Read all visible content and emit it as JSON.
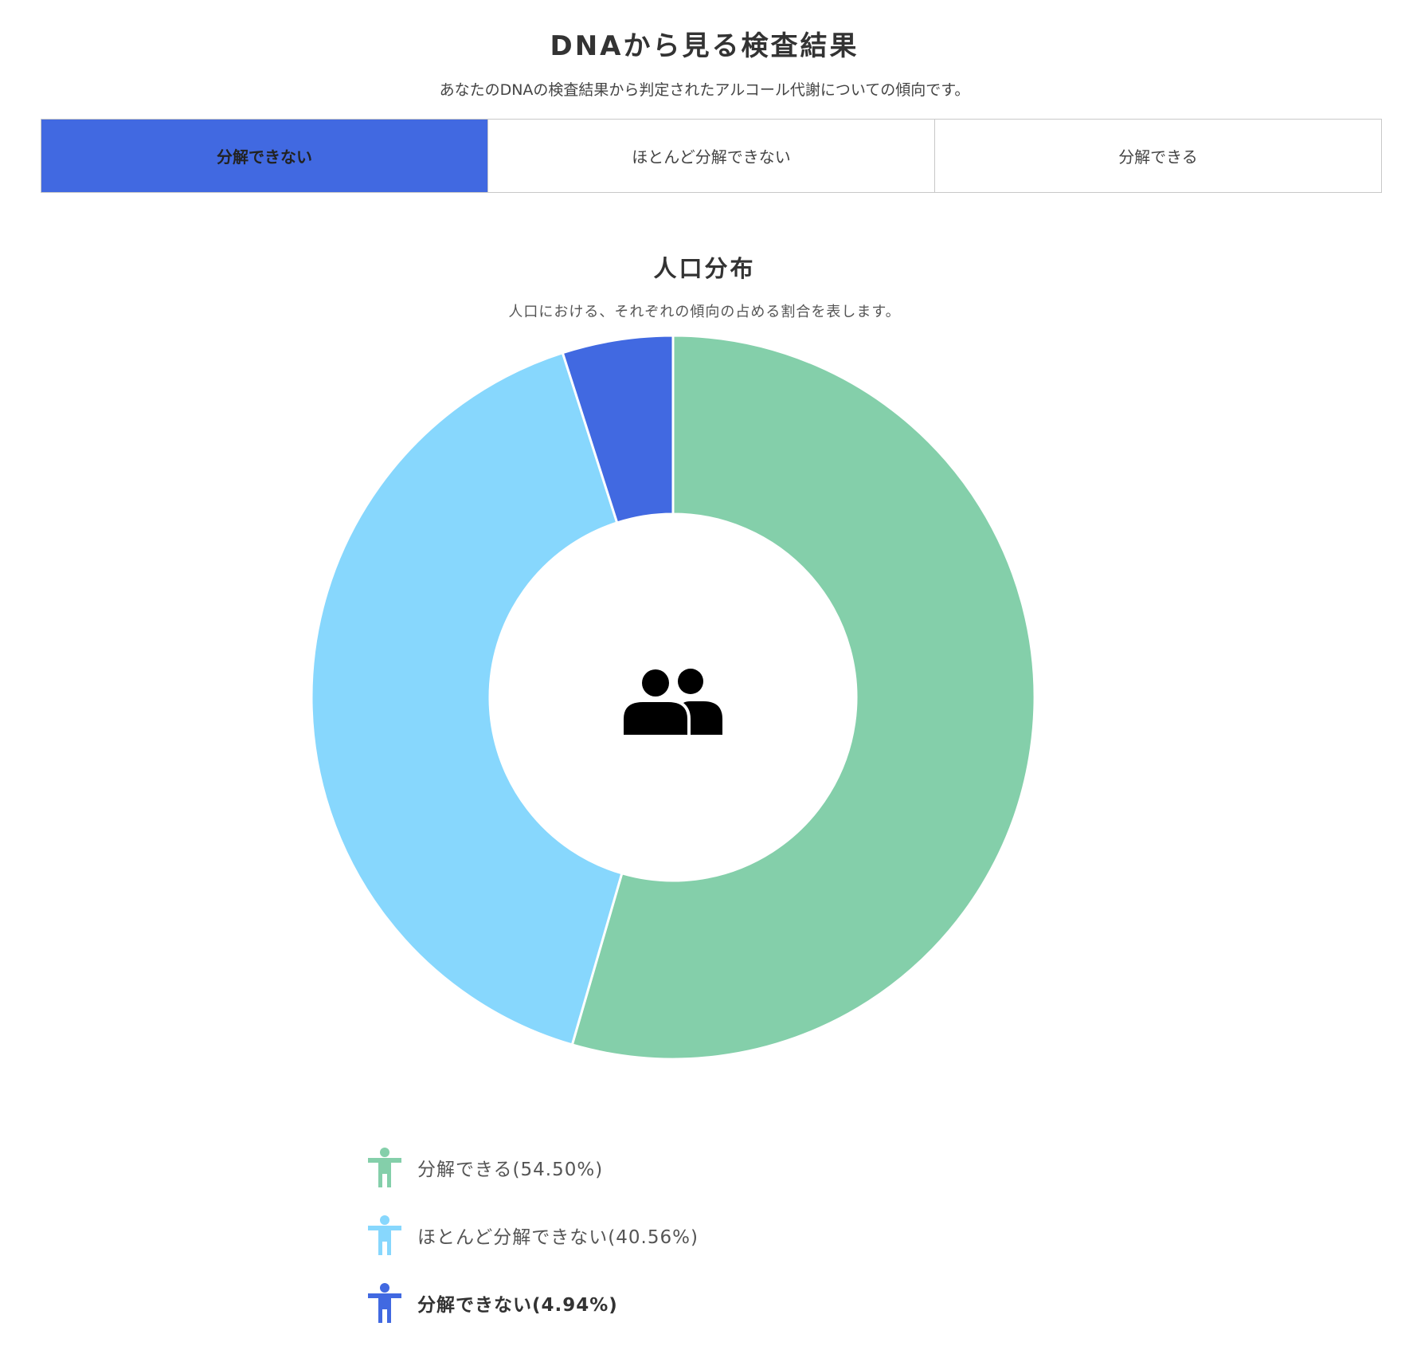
{
  "header": {
    "title": "DNAから見る検査結果",
    "subtitle": "あなたのDNAの検査結果から判定されたアルコール代謝についての傾向です。"
  },
  "tabs": [
    {
      "label": "分解できない",
      "active": true
    },
    {
      "label": "ほとんど分解できない",
      "active": false
    },
    {
      "label": "分解できる",
      "active": false
    }
  ],
  "section": {
    "title": "人口分布",
    "subtitle": "人口における、それぞれの傾向の占める割合を表します。",
    "center_icon": "people-icon"
  },
  "chart_data": {
    "type": "pie",
    "style": "donut",
    "title": "",
    "categories": [
      "分解できる",
      "ほとんど分解できない",
      "分解できない"
    ],
    "values": [
      54.5,
      40.56,
      4.94
    ],
    "unit": "%",
    "colors": [
      "#84cfaa",
      "#87d7fd",
      "#4169e1"
    ],
    "start_angle": "top, clockwise",
    "legend": {
      "placement": "bottom-left",
      "icon": "person-icon",
      "items": [
        {
          "label": "分解できる(54.50%)",
          "highlight": false
        },
        {
          "label": "ほとんど分解できない(40.56%)",
          "highlight": false
        },
        {
          "label": "分解できない(4.94%)",
          "highlight": true
        }
      ]
    }
  }
}
